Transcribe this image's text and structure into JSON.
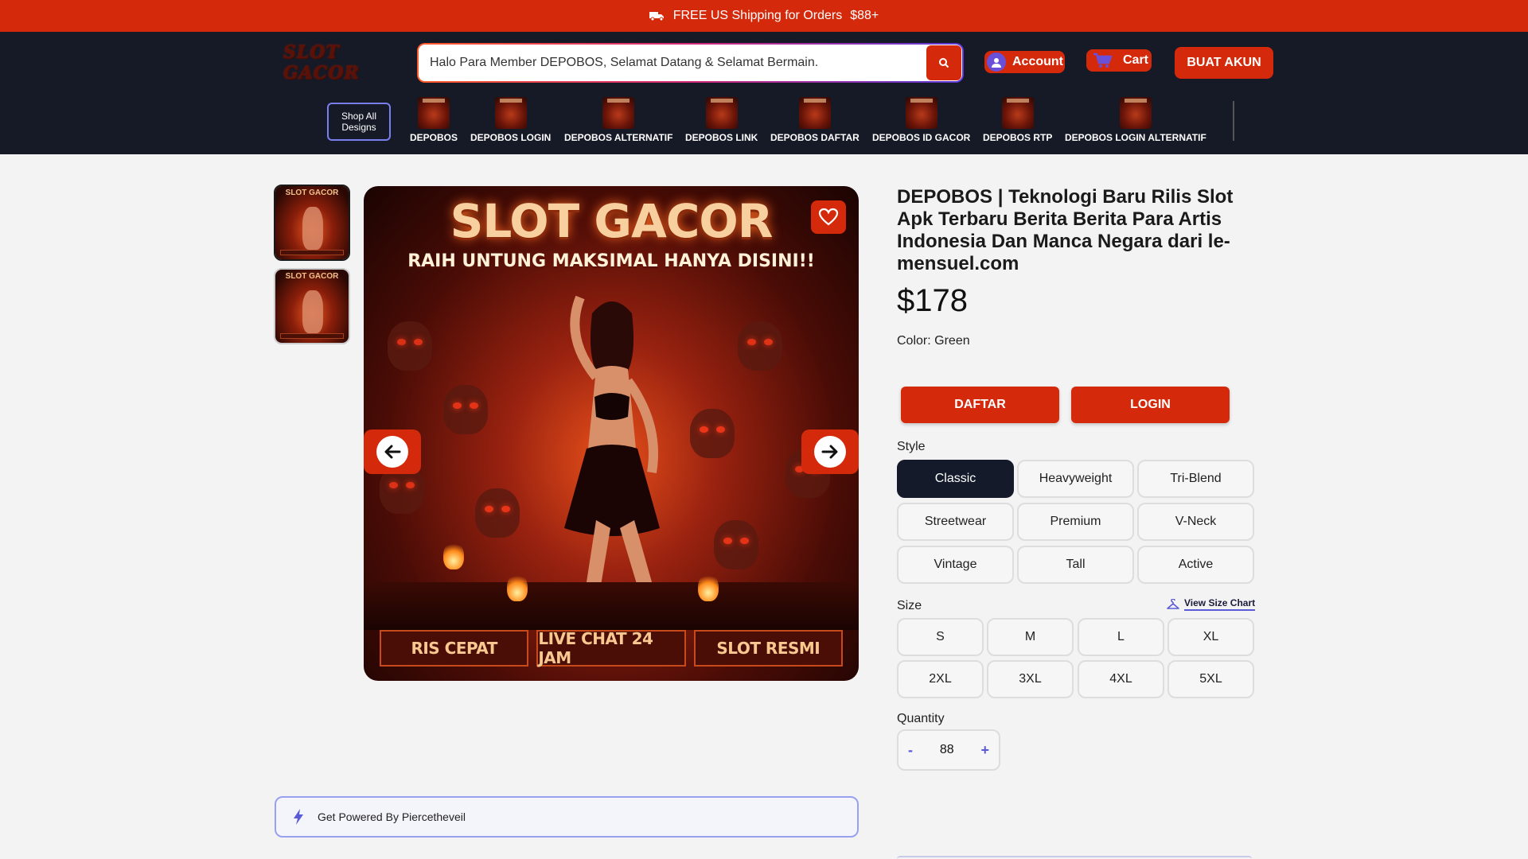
{
  "announcement": {
    "text": "FREE US Shipping for Orders",
    "amount": "$88+"
  },
  "header": {
    "logo_text": "SLOT GACOR",
    "search": {
      "value": "Halo Para Member DEPOBOS, Selamat Datang & Selamat Bermain."
    },
    "account_label": "Account",
    "cart_label": "Cart",
    "signup_label": "BUAT AKUN"
  },
  "nav": {
    "shop_all": "Shop All Designs",
    "categories": [
      {
        "label": "DEPOBOS"
      },
      {
        "label": "DEPOBOS LOGIN"
      },
      {
        "label": "DEPOBOS ALTERNATIF"
      },
      {
        "label": "DEPOBOS LINK"
      },
      {
        "label": "DEPOBOS DAFTAR"
      },
      {
        "label": "DEPOBOS ID GACOR"
      },
      {
        "label": "DEPOBOS RTP"
      },
      {
        "label": "DEPOBOS LOGIN ALTERNATIF"
      }
    ]
  },
  "gallery": {
    "thumb_text": "SLOT GACOR",
    "main": {
      "title": "SLOT GACOR",
      "subtitle": "RAIH UNTUNG MAKSIMAL HANYA DISINI!!",
      "badges": [
        "RIS CEPAT",
        "LIVE CHAT 24 JAM",
        "SLOT RESMI"
      ]
    }
  },
  "product": {
    "title": "DEPOBOS | Teknologi Baru Rilis Slot Apk Terbaru Berita Berita Para Artis Indonesia Dan Manca Negara dari le-mensuel.com",
    "price": "$178",
    "color_label": "Color:",
    "color_value": "Green",
    "daftar_label": "DAFTAR",
    "login_label": "LOGIN",
    "style_label": "Style",
    "styles": [
      "Classic",
      "Heavyweight",
      "Tri-Blend",
      "Streetwear",
      "Premium",
      "V-Neck",
      "Vintage",
      "Tall",
      "Active"
    ],
    "selected_style": "Classic",
    "size_label": "Size",
    "size_chart_label": "View Size Chart",
    "sizes": [
      "S",
      "M",
      "L",
      "XL",
      "2XL",
      "3XL",
      "4XL",
      "5XL"
    ],
    "quantity_label": "Quantity",
    "quantity": "88",
    "qty_minus": "-",
    "qty_plus": "+"
  },
  "powered_by": "Get Powered By Piercetheveil",
  "colors": {
    "accent": "#d42a0b",
    "header_bg": "#151a26",
    "page_bg": "#f3f3f3",
    "selected_option": "#141a2a",
    "link_accent": "#5a5ad8"
  }
}
